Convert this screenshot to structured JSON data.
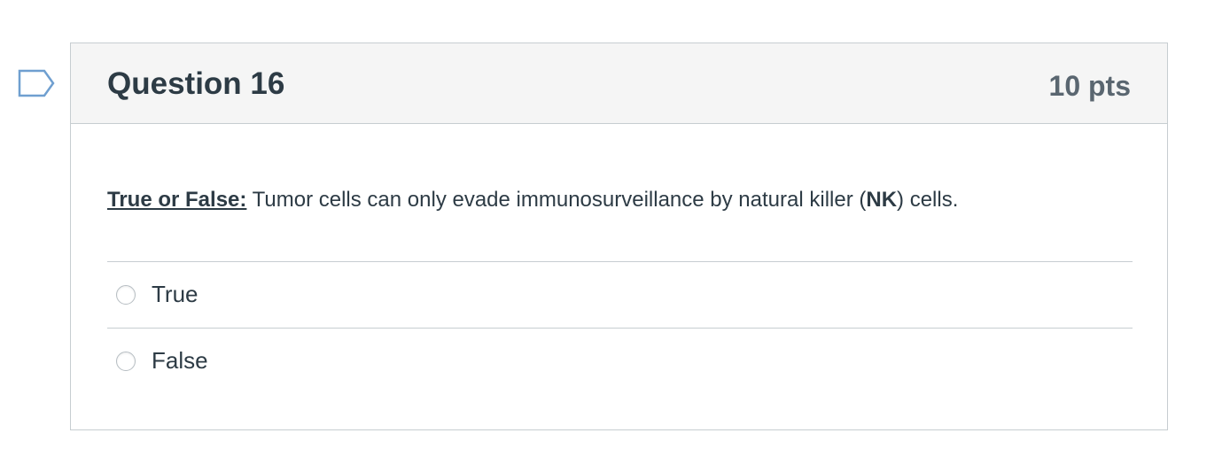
{
  "question": {
    "title": "Question 16",
    "points": "10 pts",
    "prompt_lead": "True or False:",
    "prompt_text_1": " Tumor cells can only evade immunosurveillance by natural killer (",
    "prompt_bold": "NK",
    "prompt_text_2": ") cells.",
    "answers": [
      {
        "label": "True",
        "selected": false
      },
      {
        "label": "False",
        "selected": false
      }
    ]
  },
  "icons": {
    "flag": "flag-question-icon"
  },
  "colors": {
    "text": "#2d3b45",
    "header_bg": "#f5f5f5",
    "border": "#c7cdd1",
    "flag_outline": "#6f9fd0"
  }
}
